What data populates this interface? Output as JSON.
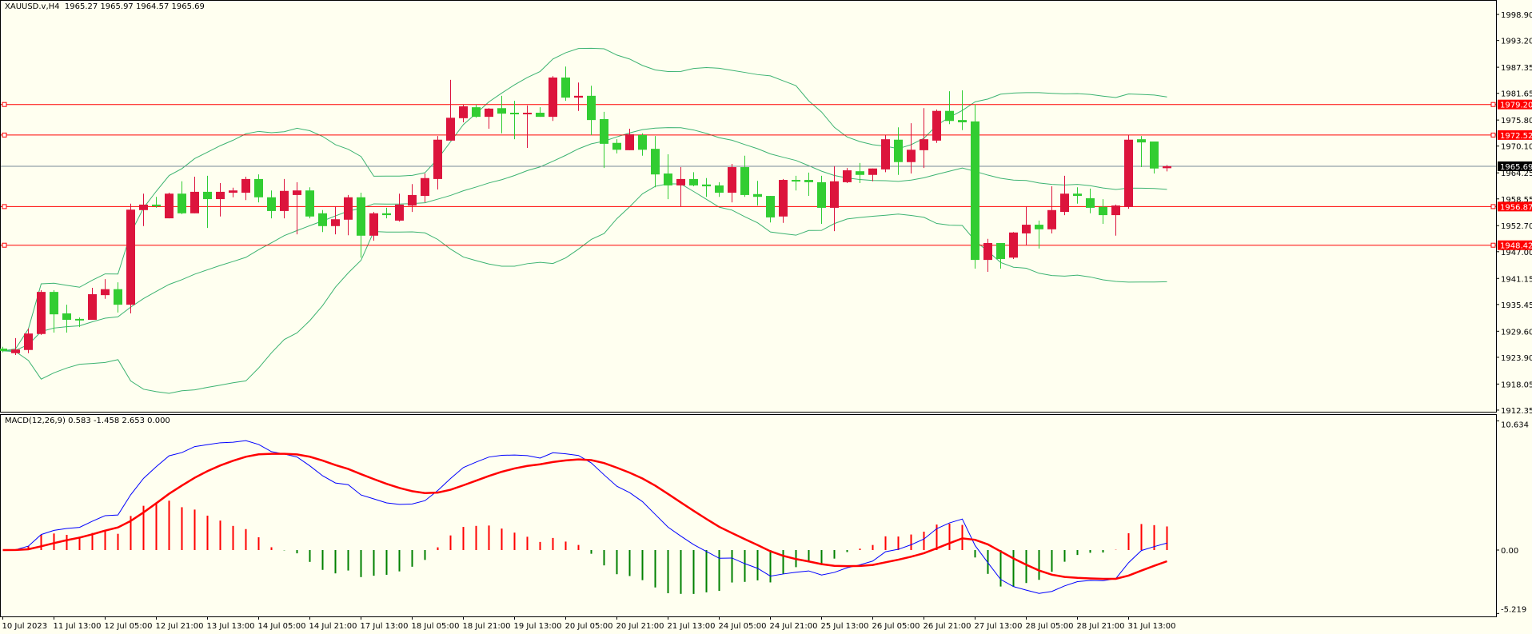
{
  "header": {
    "symbol": "XAUUSD.v,H4",
    "ohlc": "1965.27 1965.97 1964.57 1965.69"
  },
  "macd_label": {
    "name": "MACD(12,26,9)",
    "values": "0.583 -1.458 2.653 0.000"
  },
  "colors": {
    "background": "#FFFFF0",
    "bull": "#DC143C",
    "bear": "#32CD32",
    "bands": "#3CB371",
    "level": "#FF0000",
    "macd": "#0000FF",
    "signal": "#FF0000",
    "hist_pos": "#FF0000",
    "hist_neg": "#008000",
    "price_line": "#778899"
  },
  "chart_data": [
    {
      "type": "candlestick",
      "title": "XAUUSD.v,H4",
      "ylim": [
        1912.35,
        2001.5
      ],
      "y_ticks": [
        "1998.90",
        "1993.20",
        "1987.35",
        "1981.65",
        "1975.80",
        "1970.10",
        "1964.25",
        "1958.55",
        "1952.70",
        "1947.00",
        "1941.15",
        "1935.45",
        "1929.60",
        "1923.90",
        "1918.05",
        "1912.35"
      ],
      "x_labels": [
        {
          "bar": 0,
          "text": "10 Jul 2023"
        },
        {
          "bar": 4,
          "text": "11 Jul 13:00"
        },
        {
          "bar": 8,
          "text": "12 Jul 05:00"
        },
        {
          "bar": 12,
          "text": "12 Jul 21:00"
        },
        {
          "bar": 16,
          "text": "13 Jul 13:00"
        },
        {
          "bar": 20,
          "text": "14 Jul 05:00"
        },
        {
          "bar": 24,
          "text": "14 Jul 21:00"
        },
        {
          "bar": 28,
          "text": "17 Jul 13:00"
        },
        {
          "bar": 32,
          "text": "18 Jul 05:00"
        },
        {
          "bar": 36,
          "text": "18 Jul 21:00"
        },
        {
          "bar": 40,
          "text": "19 Jul 13:00"
        },
        {
          "bar": 44,
          "text": "20 Jul 05:00"
        },
        {
          "bar": 48,
          "text": "20 Jul 21:00"
        },
        {
          "bar": 52,
          "text": "21 Jul 13:00"
        },
        {
          "bar": 56,
          "text": "24 Jul 05:00"
        },
        {
          "bar": 60,
          "text": "24 Jul 21:00"
        },
        {
          "bar": 64,
          "text": "25 Jul 13:00"
        },
        {
          "bar": 68,
          "text": "26 Jul 05:00"
        },
        {
          "bar": 72,
          "text": "26 Jul 21:00"
        },
        {
          "bar": 76,
          "text": "27 Jul 13:00"
        },
        {
          "bar": 80,
          "text": "28 Jul 05:00"
        },
        {
          "bar": 84,
          "text": "28 Jul 21:00"
        },
        {
          "bar": 88,
          "text": "31 Jul 13:00"
        }
      ],
      "levels": [
        "1979.20",
        "1972.52",
        "1956.87",
        "1948.42"
      ],
      "current_price": "1965.69",
      "bollinger": {
        "period": 20,
        "deviations": 2
      },
      "ohlc": [
        [
          1925.8,
          1926.2,
          1925.0,
          1925.3
        ],
        [
          1924.8,
          1928.1,
          1924.4,
          1925.6
        ],
        [
          1925.5,
          1930.2,
          1924.8,
          1929.1
        ],
        [
          1929.0,
          1938.6,
          1928.8,
          1938.2
        ],
        [
          1938.2,
          1938.6,
          1929.3,
          1933.3
        ],
        [
          1933.5,
          1935.4,
          1929.3,
          1932.1
        ],
        [
          1932.3,
          1932.6,
          1930.5,
          1932.0
        ],
        [
          1932.1,
          1939.1,
          1932.1,
          1937.7
        ],
        [
          1937.5,
          1941.0,
          1936.7,
          1938.8
        ],
        [
          1938.8,
          1940.3,
          1933.7,
          1935.4
        ],
        [
          1935.4,
          1957.5,
          1933.5,
          1956.2
        ],
        [
          1956.1,
          1959.7,
          1952.6,
          1957.3
        ],
        [
          1957.3,
          1959.0,
          1956.6,
          1957.1
        ],
        [
          1954.3,
          1959.9,
          1954.3,
          1959.7
        ],
        [
          1959.7,
          1962.4,
          1955.2,
          1955.4
        ],
        [
          1955.4,
          1963.4,
          1955.4,
          1960.1
        ],
        [
          1960.1,
          1963.6,
          1952.2,
          1958.5
        ],
        [
          1958.5,
          1962.0,
          1954.7,
          1960.1
        ],
        [
          1959.9,
          1961.0,
          1958.9,
          1960.4
        ],
        [
          1959.9,
          1963.4,
          1958.3,
          1962.9
        ],
        [
          1962.9,
          1963.9,
          1957.8,
          1958.9
        ],
        [
          1958.9,
          1960.4,
          1954.3,
          1955.9
        ],
        [
          1955.9,
          1962.9,
          1954.3,
          1960.3
        ],
        [
          1959.4,
          1962.2,
          1950.8,
          1960.4
        ],
        [
          1960.4,
          1961.1,
          1954.3,
          1954.7
        ],
        [
          1955.4,
          1956.1,
          1951.3,
          1952.6
        ],
        [
          1952.6,
          1956.9,
          1950.8,
          1954.1
        ],
        [
          1954.0,
          1959.4,
          1950.6,
          1958.9
        ],
        [
          1958.9,
          1959.9,
          1945.7,
          1950.5
        ],
        [
          1950.5,
          1955.7,
          1949.4,
          1955.4
        ],
        [
          1955.4,
          1956.6,
          1954.3,
          1955.0
        ],
        [
          1953.8,
          1959.7,
          1953.6,
          1957.3
        ],
        [
          1957.1,
          1961.8,
          1955.7,
          1959.4
        ],
        [
          1959.2,
          1964.1,
          1957.8,
          1963.1
        ],
        [
          1962.9,
          1972.3,
          1960.6,
          1971.5
        ],
        [
          1971.3,
          1984.6,
          1971.3,
          1976.3
        ],
        [
          1976.2,
          1979.2,
          1975.3,
          1978.8
        ],
        [
          1978.6,
          1979.2,
          1976.3,
          1976.5
        ],
        [
          1976.5,
          1978.4,
          1973.9,
          1978.3
        ],
        [
          1978.4,
          1981.1,
          1972.9,
          1977.2
        ],
        [
          1977.4,
          1980.0,
          1971.6,
          1977.1
        ],
        [
          1977.1,
          1979.0,
          1969.7,
          1977.4
        ],
        [
          1977.4,
          1978.6,
          1976.5,
          1976.5
        ],
        [
          1976.5,
          1985.4,
          1975.6,
          1985.1
        ],
        [
          1985.1,
          1987.5,
          1980.0,
          1980.7
        ],
        [
          1980.7,
          1984.0,
          1977.8,
          1981.1
        ],
        [
          1981.1,
          1983.3,
          1972.5,
          1975.8
        ],
        [
          1976.0,
          1977.6,
          1965.3,
          1970.6
        ],
        [
          1970.8,
          1971.6,
          1968.5,
          1969.3
        ],
        [
          1969.2,
          1973.9,
          1969.2,
          1972.7
        ],
        [
          1972.5,
          1972.9,
          1968.0,
          1969.3
        ],
        [
          1969.5,
          1972.3,
          1961.1,
          1963.9
        ],
        [
          1964.1,
          1968.3,
          1958.5,
          1961.5
        ],
        [
          1961.5,
          1965.5,
          1956.8,
          1962.9
        ],
        [
          1962.9,
          1964.4,
          1961.3,
          1961.5
        ],
        [
          1961.7,
          1963.1,
          1959.0,
          1961.3
        ],
        [
          1961.5,
          1962.2,
          1959.0,
          1959.9
        ],
        [
          1959.9,
          1966.2,
          1957.8,
          1965.5
        ],
        [
          1965.5,
          1968.0,
          1959.0,
          1959.4
        ],
        [
          1959.6,
          1962.5,
          1957.1,
          1959.0
        ],
        [
          1959.2,
          1959.2,
          1953.4,
          1954.5
        ],
        [
          1954.7,
          1962.9,
          1953.3,
          1962.7
        ],
        [
          1962.7,
          1963.6,
          1960.4,
          1962.5
        ],
        [
          1962.7,
          1964.3,
          1959.2,
          1962.2
        ],
        [
          1962.2,
          1963.6,
          1953.1,
          1956.6
        ],
        [
          1956.6,
          1965.7,
          1951.5,
          1962.4
        ],
        [
          1962.2,
          1965.3,
          1962.0,
          1964.8
        ],
        [
          1964.6,
          1966.4,
          1962.0,
          1963.8
        ],
        [
          1963.8,
          1965.2,
          1962.4,
          1965.2
        ],
        [
          1965.0,
          1972.5,
          1964.4,
          1971.6
        ],
        [
          1971.5,
          1974.2,
          1963.8,
          1966.6
        ],
        [
          1966.6,
          1975.1,
          1964.1,
          1969.3
        ],
        [
          1969.2,
          1978.4,
          1965.3,
          1971.6
        ],
        [
          1971.3,
          1978.1,
          1970.8,
          1977.8
        ],
        [
          1977.8,
          1982.1,
          1974.9,
          1975.6
        ],
        [
          1975.8,
          1982.3,
          1973.6,
          1975.3
        ],
        [
          1975.5,
          1979.2,
          1943.3,
          1945.2
        ],
        [
          1945.2,
          1949.8,
          1942.6,
          1948.9
        ],
        [
          1948.9,
          1948.9,
          1943.3,
          1945.4
        ],
        [
          1945.7,
          1951.3,
          1945.4,
          1951.2
        ],
        [
          1951.0,
          1956.9,
          1948.4,
          1952.9
        ],
        [
          1952.9,
          1953.8,
          1947.7,
          1951.9
        ],
        [
          1951.9,
          1961.3,
          1951.0,
          1956.1
        ],
        [
          1955.7,
          1963.6,
          1955.0,
          1959.7
        ],
        [
          1959.7,
          1961.1,
          1957.5,
          1959.2
        ],
        [
          1958.7,
          1960.8,
          1955.4,
          1956.6
        ],
        [
          1956.8,
          1958.5,
          1953.1,
          1955.0
        ],
        [
          1955.0,
          1957.3,
          1950.5,
          1957.1
        ],
        [
          1956.8,
          1972.5,
          1956.4,
          1971.5
        ],
        [
          1971.6,
          1972.3,
          1965.5,
          1970.9
        ],
        [
          1971.1,
          1971.1,
          1964.1,
          1965.2
        ],
        [
          1965.27,
          1965.97,
          1964.57,
          1965.69
        ]
      ]
    },
    {
      "type": "macd",
      "title": "MACD(12,26,9)",
      "params": [
        12,
        26,
        9
      ],
      "ylim": [
        -5.219,
        10.634
      ],
      "y_ticks": [
        "10.634",
        "0.00",
        "-5.219"
      ],
      "last_values": {
        "macd": 0.583,
        "signal": -1.458,
        "histogram": 2.653
      }
    }
  ]
}
